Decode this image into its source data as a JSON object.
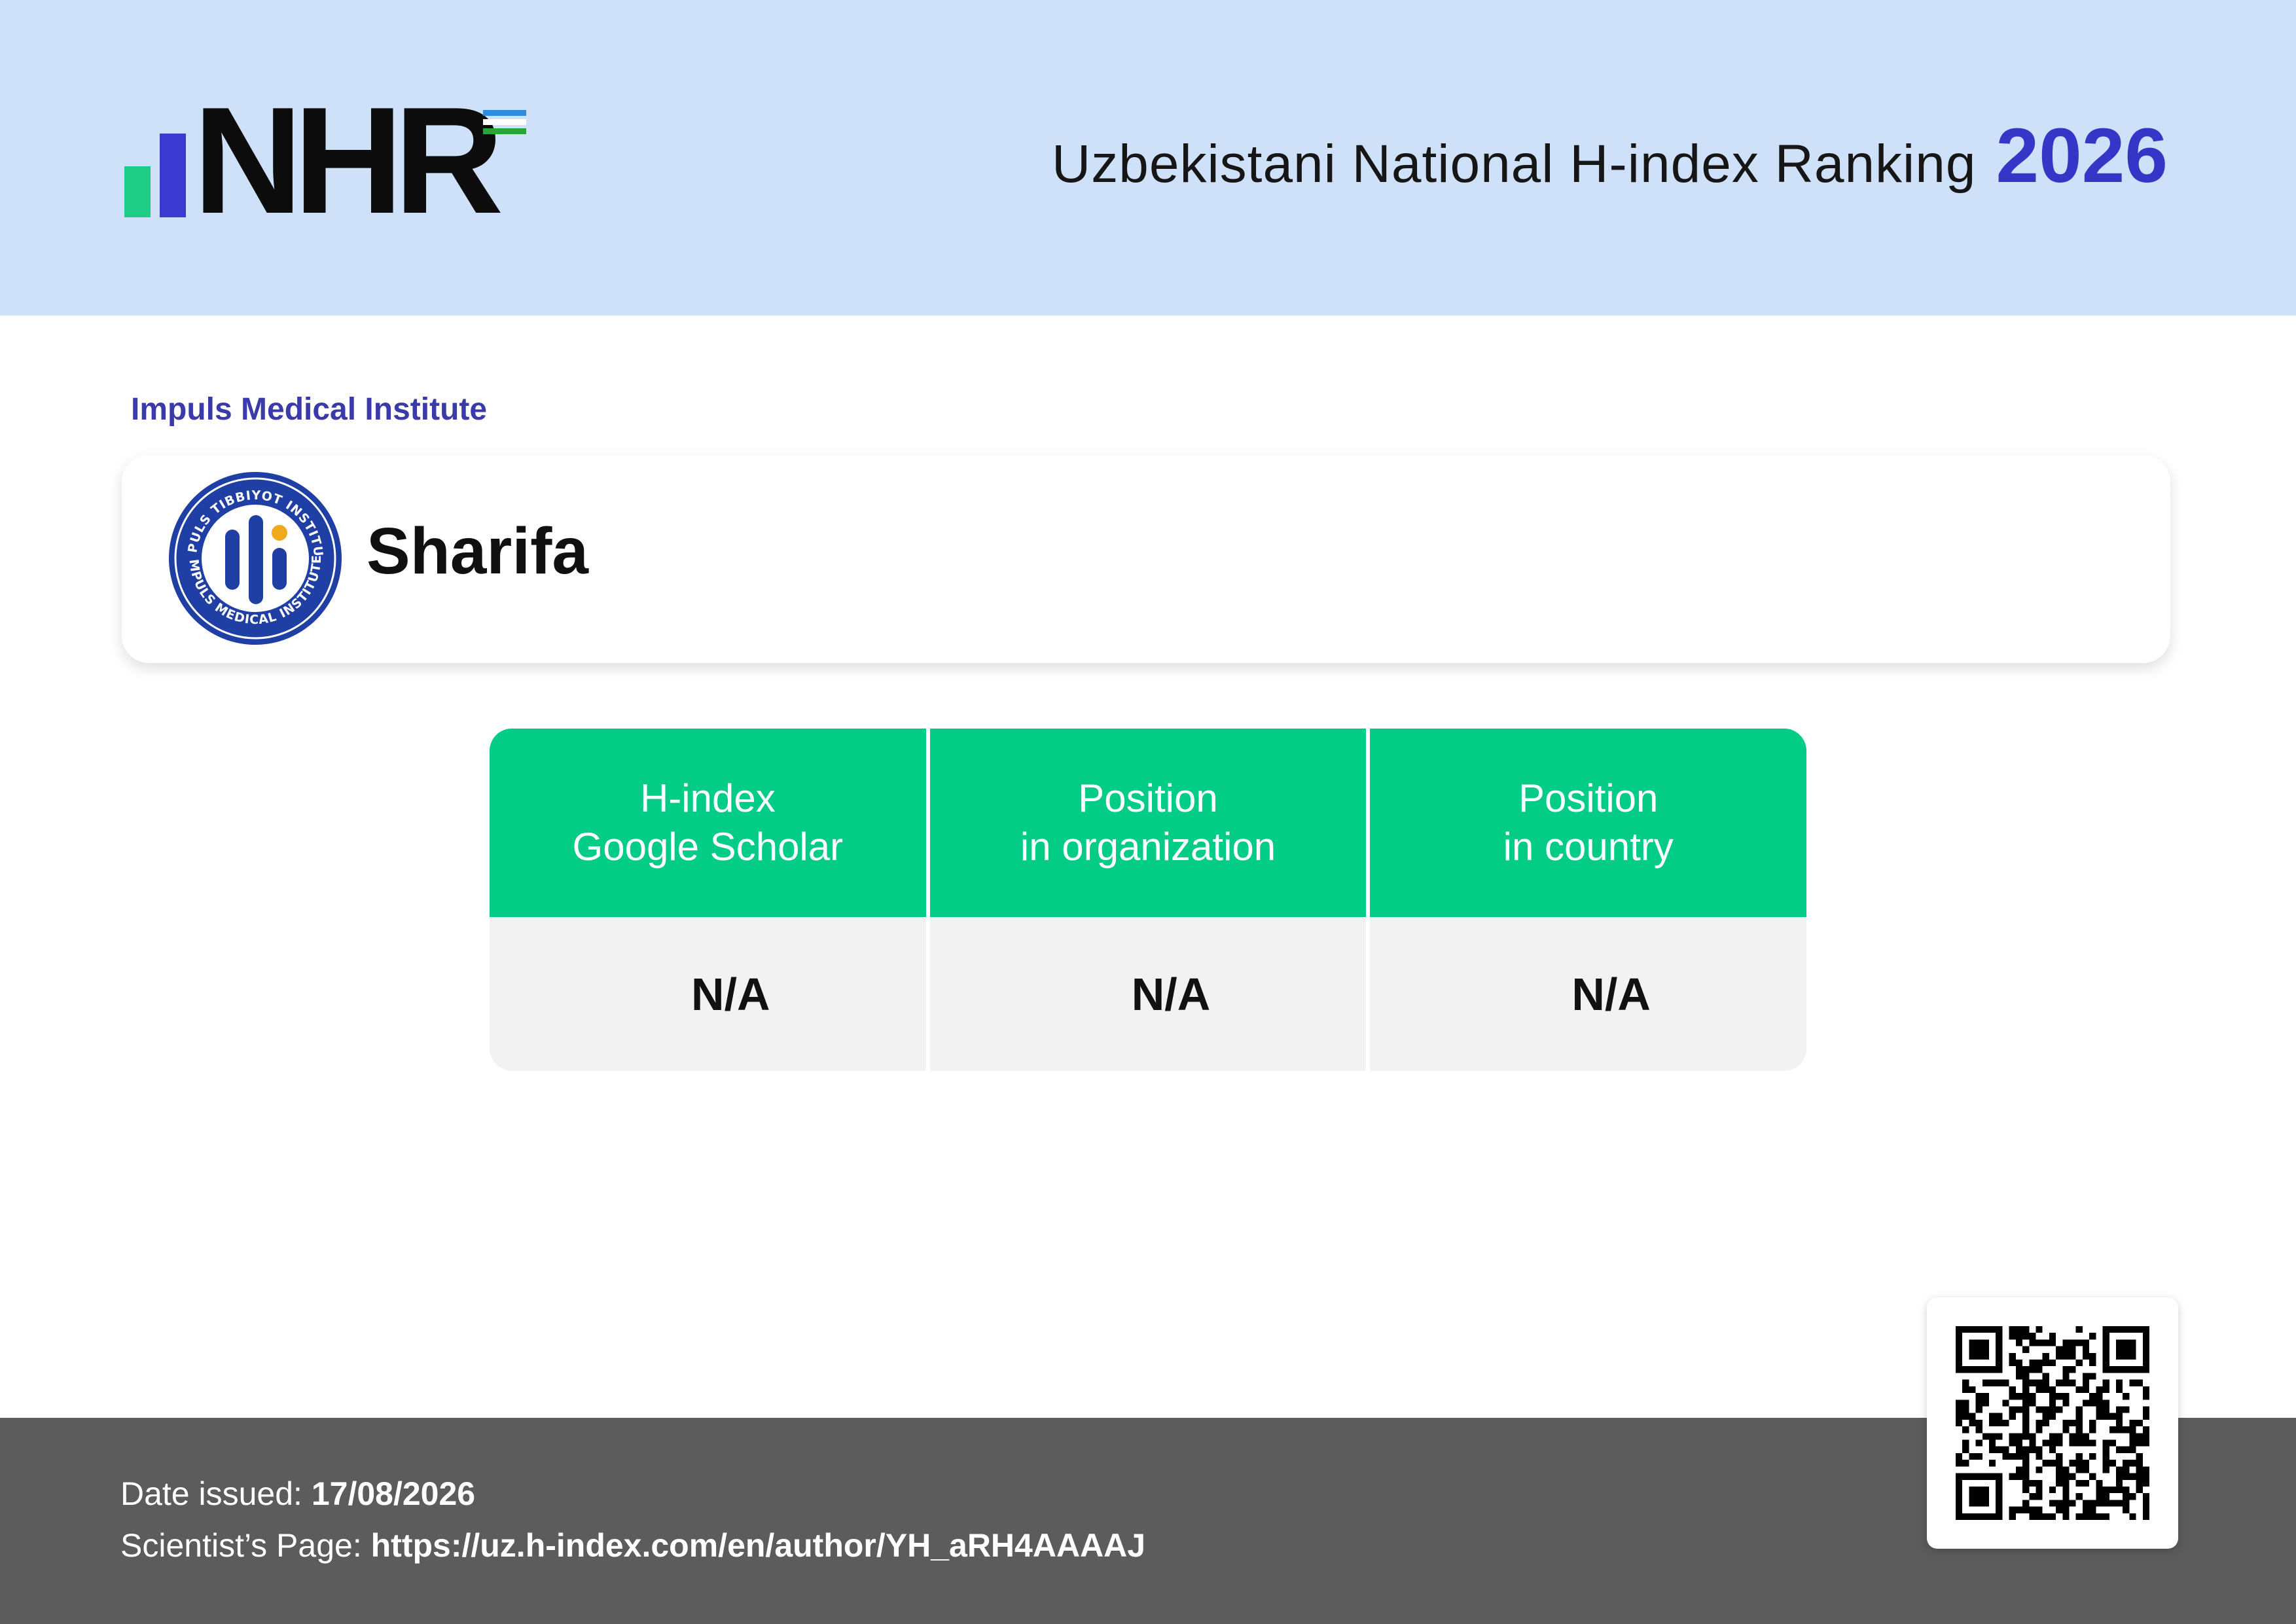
{
  "header": {
    "logo_text": "NHR",
    "title": "Uzbekistani National H-index Ranking",
    "year": "2026"
  },
  "colors": {
    "header_bg": "#cfe1f8",
    "accent_blue": "#3535c7",
    "table_green": "#03cc86",
    "footer_bg": "#5c5c5c"
  },
  "institution": {
    "name": "Impuls Medical Institute",
    "seal_top_text": "IMPULS TIBBIYOT INSTITUTI",
    "seal_bottom_text": "IMPULS MEDICAL INSTITUTE"
  },
  "person": {
    "name": "Sharifa"
  },
  "stats": [
    {
      "header_line1": "H-index",
      "header_line2": "Google Scholar",
      "value": "N/A"
    },
    {
      "header_line1": "Position",
      "header_line2": "in organization",
      "value": "N/A"
    },
    {
      "header_line1": "Position",
      "header_line2": "in country",
      "value": "N/A"
    }
  ],
  "footer": {
    "date_label": "Date issued:",
    "date_value": "17/08/2026",
    "page_label": "Scientist’s Page:",
    "page_url": "https://uz.h-index.com/en/author/YH_aRH4AAAAJ"
  },
  "icons": {
    "logo": "nhr-logo-icon",
    "seal": "institution-seal-icon",
    "qr": "qr-code-icon"
  }
}
